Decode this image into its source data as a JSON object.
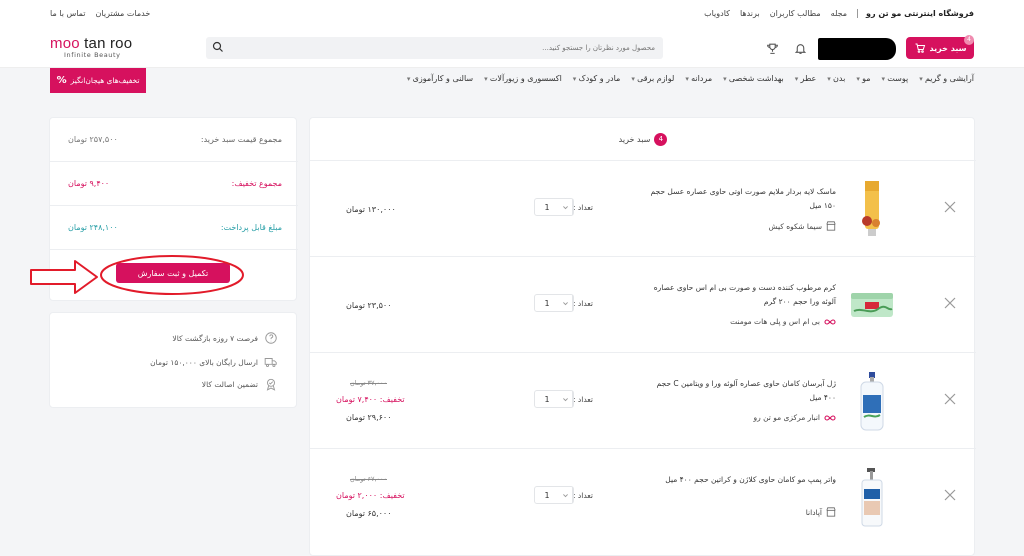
{
  "topbar": {
    "brand": "فروشگاه اینترنتی مو تن رو",
    "links": [
      "مجله",
      "مطالب کاربران",
      "برندها",
      "کادویاب"
    ],
    "left_links": [
      "خدمات مشتریان",
      "تماس با ما"
    ]
  },
  "header": {
    "cart_label": "سبد خرید",
    "cart_count": "4",
    "search_placeholder": "محصول مورد نظرتان را جستجو کنید...",
    "logo_main_a": "moo ",
    "logo_main_b": "tan roo",
    "logo_tagline": "Infinite Beauty"
  },
  "nav": {
    "items": [
      "آرایشی و گریم",
      "پوست",
      "مو",
      "بدن",
      "عطر",
      "بهداشت شخصی",
      "مردانه",
      "لوازم برقی",
      "مادر و کودک",
      "اکسسوری و زیورآلات",
      "سالنی و کارآموزی"
    ],
    "promo": "تخفیف‌های هیجان‌انگیز"
  },
  "cart": {
    "title": "سبد خرید",
    "count": "4",
    "qty_label": "تعداد :",
    "items": [
      {
        "name": "ماسک لایه بردار ملایم صورت اوتی حاوی عصاره عسل حجم ۱۵۰ میل",
        "seller": "سیما شکوه کیش",
        "qty": "1",
        "price": "۱۳۰,۰۰۰ تومان",
        "old_price": "",
        "discount": ""
      },
      {
        "name": "کرم مرطوب کننده دست و صورت بی ام اس حاوی عصاره آلوئه ورا حجم ۲۰۰ گرم",
        "seller": "بی ام اس و پلی هات مومنت",
        "qty": "1",
        "price": "۲۳,۵۰۰ تومان",
        "old_price": "",
        "discount": ""
      },
      {
        "name": "ژل آبرسان کامان حاوی عصاره آلوئه ورا و ویتامین C حجم ۴۰۰ میل",
        "seller": "انبار مرکزی مو تن رو",
        "qty": "1",
        "price": "۲۹,۶۰۰ تومان",
        "old_price": "۳۷,۰۰۰ تومان",
        "discount": "تخفیف: ۷,۴۰۰ تومان"
      },
      {
        "name": "واتر پمپ مو کامان حاوی کلاژن و کراتین حجم ۴۰۰ میل",
        "seller": "آپادانا",
        "qty": "1",
        "price": "۶۵,۰۰۰ تومان",
        "old_price": "۶۷,۰۰۰ تومان",
        "discount": "تخفیف: ۲,۰۰۰ تومان"
      }
    ]
  },
  "summary": {
    "total_label": "مجموع قیمت سبد خرید:",
    "total_value": "۲۵۷,۵۰۰ تومان",
    "discount_label": "مجموع تخفیف:",
    "discount_value": "۹,۴۰۰ تومان",
    "payable_label": "مبلغ قابل پرداخت:",
    "payable_value": "۲۴۸,۱۰۰ تومان",
    "order_button": "تکمیل و ثبت سفارش"
  },
  "features": [
    "فرصت ۷ روزه بازگشت کالا",
    "ارسال رایگان بالای ۱۵۰,۰۰۰ تومان",
    "تضمین اصالت کالا"
  ],
  "colors": {
    "accent": "#d6115e",
    "discount": "#d6115e",
    "payable": "#2aa0a8",
    "annotation": "#e21b2a"
  }
}
